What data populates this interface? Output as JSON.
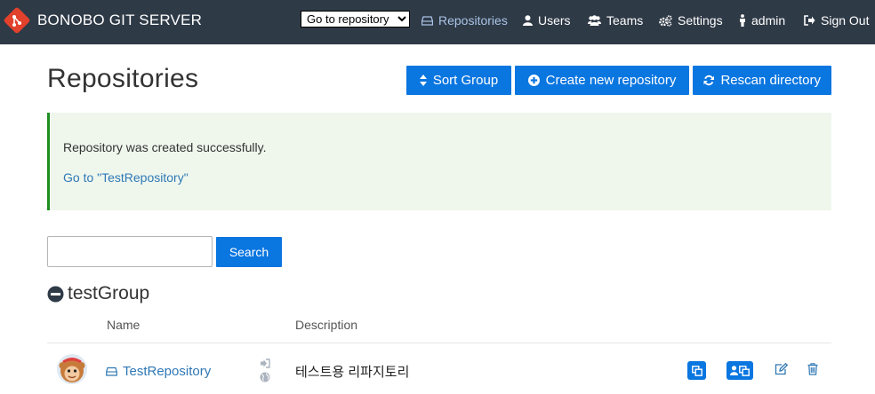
{
  "navbar": {
    "brand": "BONOBO GIT SERVER",
    "repo_select": {
      "selected": "Go to repository",
      "options": [
        "Go to repository"
      ]
    },
    "items": [
      {
        "label": "Repositories",
        "icon": "hdd-icon",
        "active": true
      },
      {
        "label": "Users",
        "icon": "user-icon"
      },
      {
        "label": "Teams",
        "icon": "users-icon"
      },
      {
        "label": "Settings",
        "icon": "cogs-icon"
      },
      {
        "label": "admin",
        "icon": "person-icon"
      },
      {
        "label": "Sign Out",
        "icon": "sign-out-icon"
      }
    ]
  },
  "page": {
    "title": "Repositories",
    "buttons": {
      "sort_group": "Sort Group",
      "create": "Create new repository",
      "rescan": "Rescan directory"
    }
  },
  "alert": {
    "message": "Repository was created successfully.",
    "link": "Go to \"TestRepository\""
  },
  "search": {
    "value": "",
    "placeholder": "",
    "button": "Search"
  },
  "group": {
    "name": "testGroup",
    "columns": {
      "name": "Name",
      "description": "Description"
    },
    "rows": [
      {
        "name": "TestRepository",
        "description": "테스트용 리파지토리"
      }
    ]
  },
  "colors": {
    "navbar": "#2f3a47",
    "primary": "#0a76e0",
    "alert_bg": "#eff7ed",
    "alert_border": "#1e8f21",
    "link": "#2f78b5"
  }
}
